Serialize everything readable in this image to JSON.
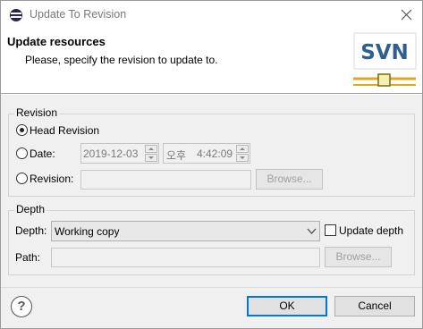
{
  "window": {
    "title": "Update To Revision"
  },
  "header": {
    "title": "Update resources",
    "message": "Please, specify the revision to update to.",
    "logo_text": "SVN"
  },
  "revision_group": {
    "label": "Revision",
    "head_revision": {
      "label": "Head Revision",
      "checked": true
    },
    "date": {
      "label": "Date:",
      "checked": false,
      "date_value": "2019-12-03",
      "ampm_value": "오후",
      "time_value": "4:42:09"
    },
    "revision": {
      "label": "Revision:",
      "checked": false,
      "value": "",
      "browse_label": "Browse..."
    }
  },
  "depth_group": {
    "label": "Depth",
    "depth_label": "Depth:",
    "depth_value": "Working copy",
    "update_depth_label": "Update depth",
    "update_depth_checked": false,
    "path_label": "Path:",
    "path_value": "",
    "browse_label": "Browse..."
  },
  "buttons": {
    "help_glyph": "?",
    "ok_label": "OK",
    "cancel_label": "Cancel"
  },
  "colors": {
    "accent": "#0078d7",
    "logo_blue": "#2f5f8f",
    "logo_gold": "#e0a81c"
  },
  "icons": {
    "app": "eclipse-icon",
    "close": "close-icon",
    "help": "help-icon",
    "dropdown": "chevron-down-icon"
  }
}
